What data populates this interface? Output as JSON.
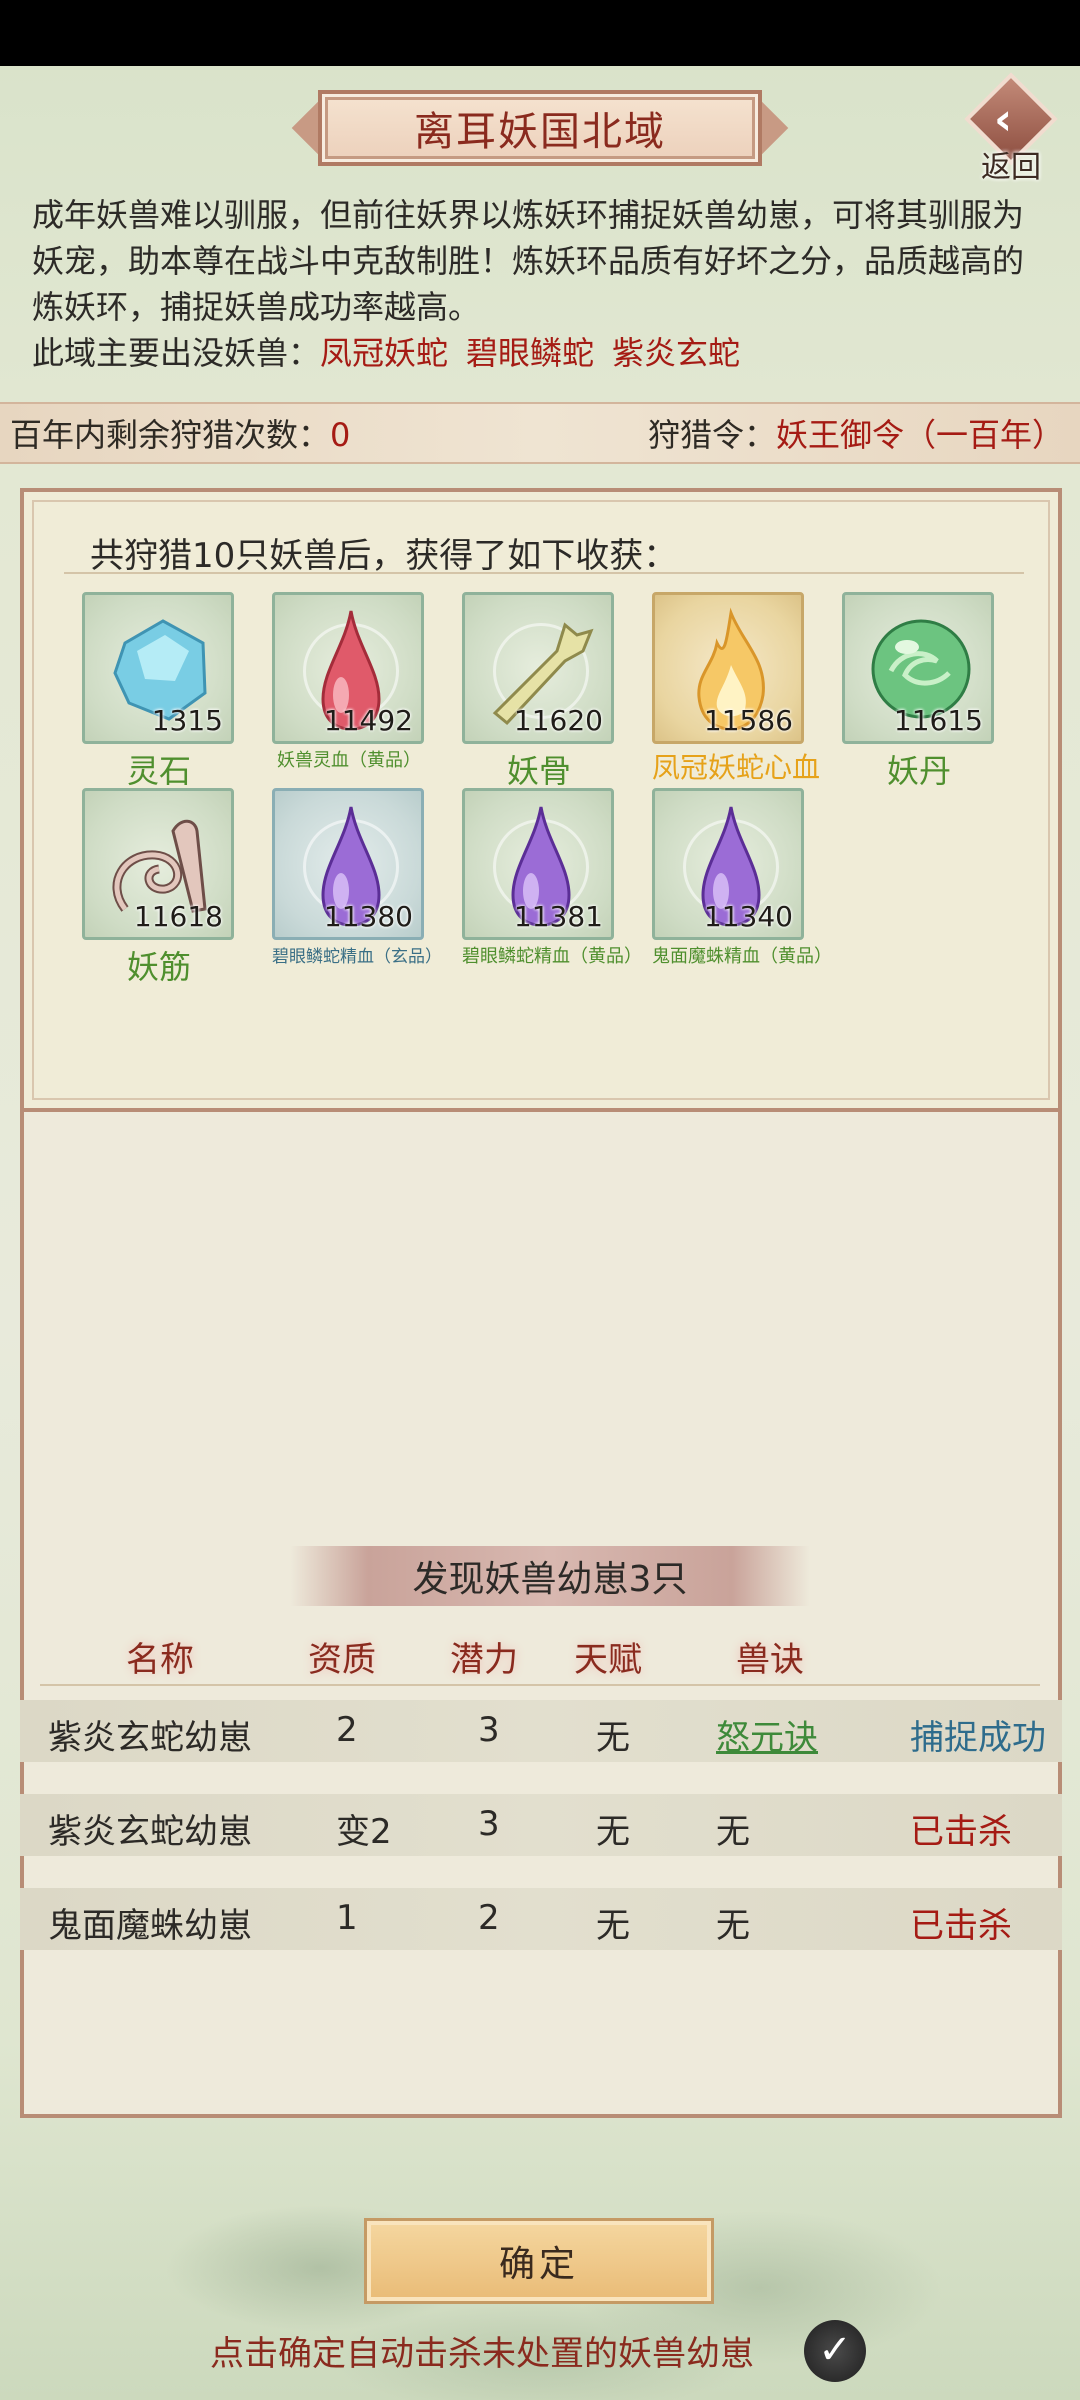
{
  "header": {
    "title": "离耳妖国北域",
    "back_label": "返回"
  },
  "intro": {
    "description": "成年妖兽难以驯服，但前往妖界以炼妖环捕捉妖兽幼崽，可将其驯服为妖宠，助本尊在战斗中克敌制胜！炼妖环品质有好坏之分，品质越高的炼妖环，捕捉妖兽成功率越高。",
    "monsters_label": "此域主要出没妖兽：",
    "monsters": [
      "凤冠妖蛇",
      "碧眼鳞蛇",
      "紫炎玄蛇"
    ]
  },
  "info_bar": {
    "remaining_label": "百年内剩余狩猎次数：",
    "remaining_value": "0",
    "token_label": "狩猎令：",
    "token_value": "妖王御令（一百年）"
  },
  "rewards": {
    "heading": "共狩猎10只妖兽后，获得了如下收获：",
    "items": [
      {
        "name": "灵石",
        "count": "1315",
        "icon": "crystal-icon"
      },
      {
        "name": "妖兽灵血（黄品）",
        "count": "11492",
        "icon": "red-blood-drop-icon"
      },
      {
        "name": "妖骨",
        "count": "11620",
        "icon": "bone-icon"
      },
      {
        "name": "凤冠妖蛇心血",
        "count": "11586",
        "icon": "flame-icon"
      },
      {
        "name": "妖丹",
        "count": "11615",
        "icon": "green-orb-icon"
      },
      {
        "name": "妖筋",
        "count": "11618",
        "icon": "tendon-icon"
      },
      {
        "name": "碧眼鳞蛇精血（玄品）",
        "count": "11380",
        "icon": "purple-blood-drop-icon"
      },
      {
        "name": "碧眼鳞蛇精血（黄品）",
        "count": "11381",
        "icon": "purple-blood-drop-icon"
      },
      {
        "name": "鬼面魔蛛精血（黄品）",
        "count": "11340",
        "icon": "purple-blood-drop-icon"
      }
    ]
  },
  "found": {
    "banner": "发现妖兽幼崽3只",
    "columns": [
      "名称",
      "资质",
      "潜力",
      "天赋",
      "兽诀"
    ],
    "rows": [
      {
        "name": "紫炎玄蛇幼崽",
        "aptitude": "2",
        "potential": "3",
        "talent": "无",
        "skill": "怒元诀",
        "status": "捕捉成功"
      },
      {
        "name": "紫炎玄蛇幼崽",
        "aptitude": "变2",
        "potential": "3",
        "talent": "无",
        "skill": "无",
        "status": "已击杀"
      },
      {
        "name": "鬼面魔蛛幼崽",
        "aptitude": "1",
        "potential": "2",
        "talent": "无",
        "skill": "无",
        "status": "已击杀"
      }
    ]
  },
  "footer": {
    "confirm_label": "确定",
    "auto_kill_text": "点击确定自动击杀未处置的妖兽幼崽",
    "auto_kill_checked": true
  },
  "colors": {
    "title_red": "#8a2a1e",
    "monster_red": "#a51b14",
    "item_green": "#4f8f2e",
    "item_gold": "#e6a21a",
    "status_blue": "#2e6c8c"
  }
}
